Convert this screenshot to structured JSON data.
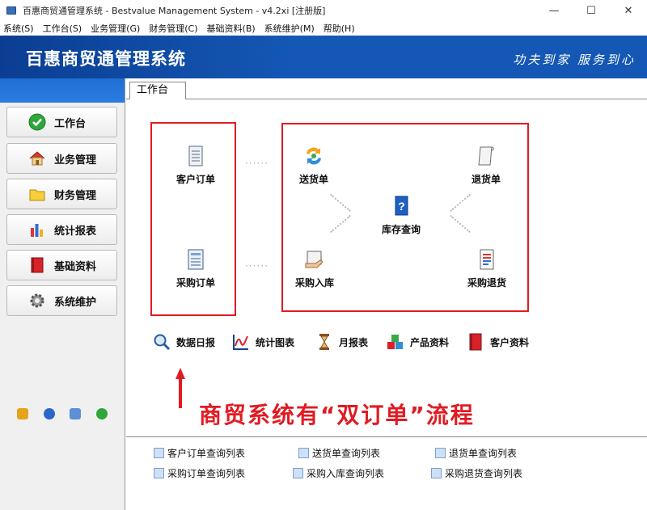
{
  "window": {
    "title": "百惠商贸通管理系统 - Bestvalue Management System - v4.2xi [注册版]",
    "minimize": "—",
    "maximize": "☐",
    "close": "✕"
  },
  "menu": [
    "系统(S)",
    "工作台(S)",
    "业务管理(G)",
    "财务管理(C)",
    "基础资料(B)",
    "系统维护(M)",
    "帮助(H)"
  ],
  "banner": {
    "logo": "百惠商贸通管理系统",
    "slogan": "功夫到家 服务到心"
  },
  "nav": [
    {
      "label": "工作台",
      "icon": "check-circle-icon"
    },
    {
      "label": "业务管理",
      "icon": "house-icon"
    },
    {
      "label": "财务管理",
      "icon": "folder-icon"
    },
    {
      "label": "统计报表",
      "icon": "bar-chart-icon"
    },
    {
      "label": "基础资料",
      "icon": "book-icon"
    },
    {
      "label": "系统维护",
      "icon": "gear-icon"
    }
  ],
  "tab": {
    "label": "工作台"
  },
  "flow": {
    "customer_order": "客户订单",
    "purchase_order": "采购订单",
    "delivery": "送货单",
    "return": "退货单",
    "stock_query": "库存查询",
    "purchase_in": "采购入库",
    "purchase_return": "采购退货",
    "dots": "······"
  },
  "quick": [
    {
      "label": "数据日报",
      "icon": "magnifier-icon"
    },
    {
      "label": "统计图表",
      "icon": "line-chart-icon"
    },
    {
      "label": "月报表",
      "icon": "hourglass-icon"
    },
    {
      "label": "产品资料",
      "icon": "cubes-icon"
    },
    {
      "label": "客户资料",
      "icon": "red-book-icon"
    }
  ],
  "annotation": "商贸系统有“双订单”流程",
  "lists": {
    "customer_order_list": "客户订单查询列表",
    "delivery_list": "送货单查询列表",
    "return_list": "退货单查询列表",
    "purchase_order_list": "采购订单查询列表",
    "purchase_in_list": "采购入库查询列表",
    "purchase_return_list": "采购退货查询列表"
  },
  "colors": {
    "banner": "#1457b4",
    "highlight": "#e11b22"
  }
}
